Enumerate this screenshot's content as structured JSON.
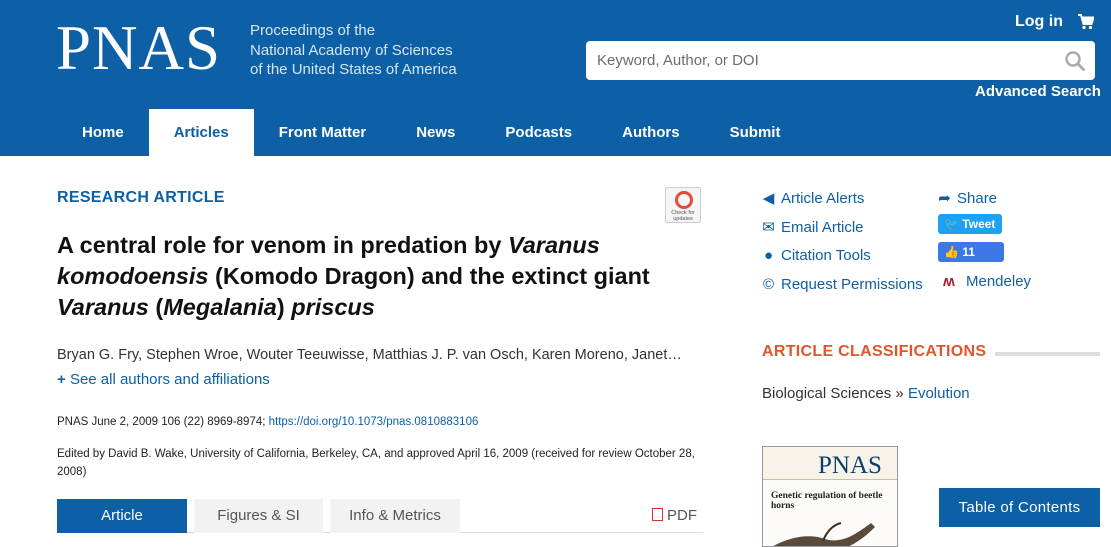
{
  "header": {
    "logo": "PNAS",
    "tagline": [
      "Proceedings of the",
      "National Academy of Sciences",
      "of the United States of America"
    ],
    "login": "Log in",
    "search_placeholder": "Keyword, Author, or DOI",
    "advanced_search": "Advanced Search",
    "nav": [
      "Home",
      "Articles",
      "Front Matter",
      "News",
      "Podcasts",
      "Authors",
      "Submit"
    ],
    "active_nav": "Articles"
  },
  "article": {
    "type": "RESEARCH ARTICLE",
    "check_updates": "Check for updates",
    "title": {
      "p1": "A central role for venom in predation by ",
      "p2": "Varanus komodoensis",
      "p3": " (Komodo Dragon) and the extinct giant ",
      "p4": "Varanus",
      "p5": " (",
      "p6": "Megalania",
      "p7": ") ",
      "p8": "priscus"
    },
    "authors": "Bryan G. Fry, Stephen Wroe, Wouter Teeuwisse, Matthias J. P. van Osch, Karen Moreno, Janet…",
    "see_all": "See all authors and affiliations",
    "see_all_prefix": "+",
    "citation": "PNAS June 2, 2009 106 (22) 8969-8974; ",
    "doi": "https://doi.org/10.1073/pnas.0810883106",
    "edited": "Edited by David B. Wake, University of California, Berkeley, CA, and approved April 16, 2009 (received for review October 28, 2008)",
    "tabs": [
      "Article",
      "Figures & SI",
      "Info & Metrics"
    ],
    "pdf": "PDF"
  },
  "sidebar": {
    "article_alerts": "Article Alerts",
    "email_article": "Email Article",
    "citation_tools": "Citation Tools",
    "request_permissions": "Request Permissions",
    "share": "Share",
    "tweet": "Tweet",
    "like_count": "11",
    "mendeley": "Mendeley",
    "classifications_heading": "ARTICLE CLASSIFICATIONS",
    "classification_parent": "Biological Sciences",
    "classification_sep": "»",
    "classification_child": "Evolution",
    "cover_logo": "PNAS",
    "cover_title": "Genetic regulation of beetle horns",
    "table_of_contents": "Table of Contents"
  },
  "colors": {
    "brand_blue": "#0d5fa6",
    "accent_orange": "#e2552b",
    "tweet_blue": "#1da1f2"
  }
}
